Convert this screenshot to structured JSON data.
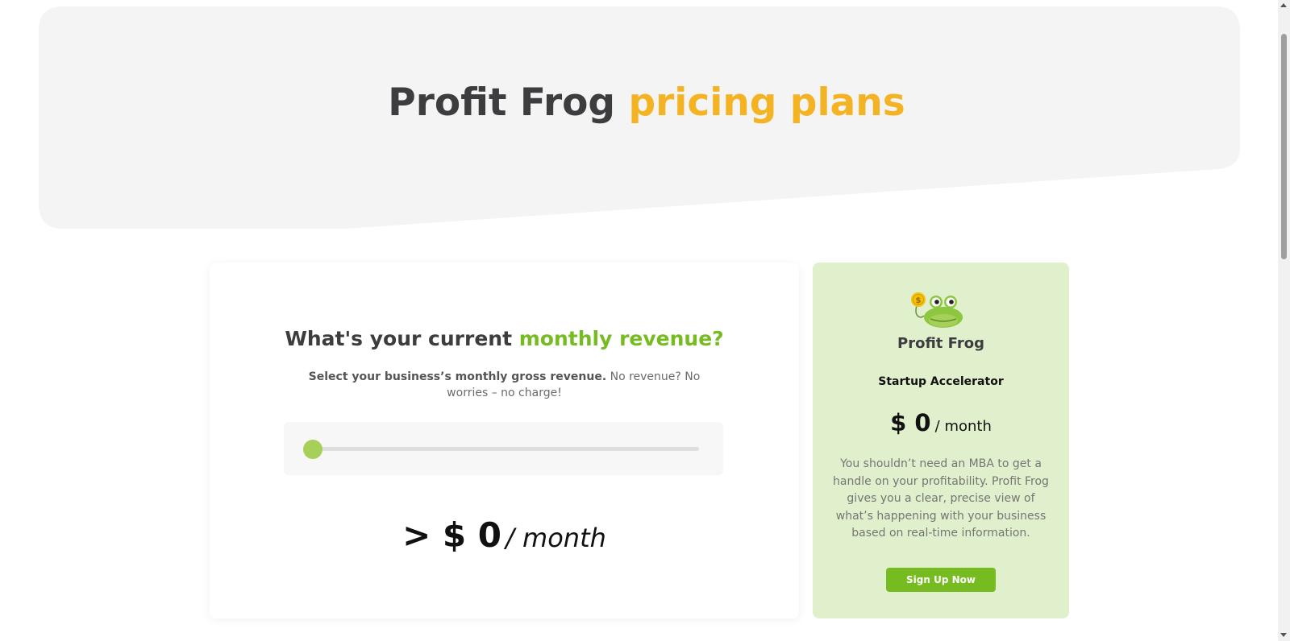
{
  "hero": {
    "title_main": "Profit Frog",
    "title_accent": "pricing plans"
  },
  "revenue": {
    "heading_main": "What's your current",
    "heading_accent": "monthly revenue?",
    "sub_bold": "Select your business’s monthly gross revenue.",
    "sub_rest": "No revenue? No worries – no charge!",
    "slider_value_fraction": 0,
    "amount_prefix": "> $ 0",
    "amount_suffix": "/ month"
  },
  "plan": {
    "logo_icon": "profit-frog-logo",
    "brand": "Profit Frog",
    "name": "Startup Accelerator",
    "price": "$ 0",
    "price_suffix": "/ month",
    "description": "You shouldn’t need an MBA to get a handle on your profitability. Profit Frog gives you a clear, precise view of what’s happening with your business based on real-time information.",
    "cta_label": "Sign Up Now"
  },
  "colors": {
    "accent_orange": "#f4b322",
    "accent_green": "#76bc21",
    "slider_green": "#a6d05a",
    "plan_card_bg": "#e1f0cc",
    "hero_bg": "#f4f4f4"
  }
}
